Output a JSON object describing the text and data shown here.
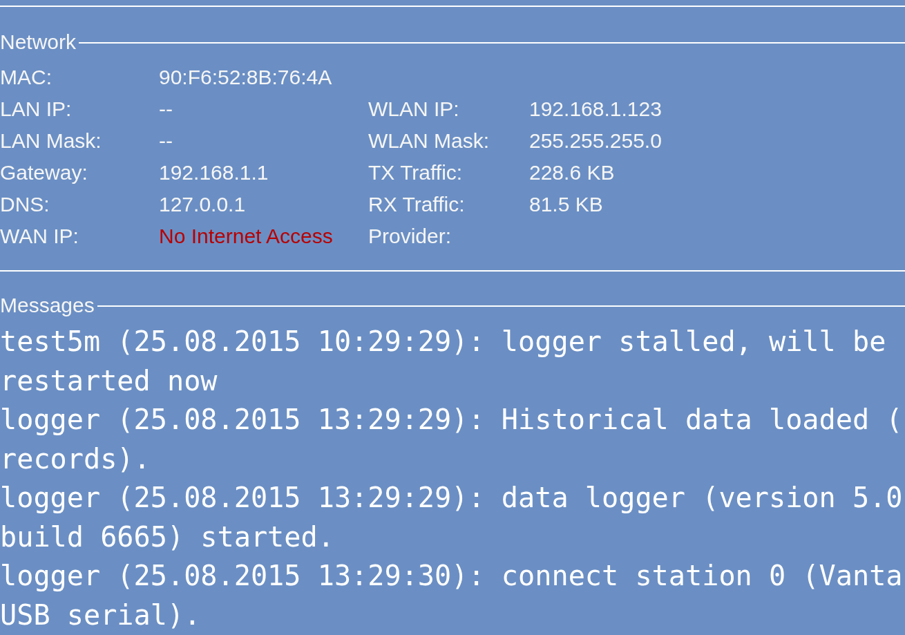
{
  "network": {
    "title": "Network",
    "rows": [
      {
        "pairs": [
          {
            "label": "MAC:",
            "value": "90:F6:52:8B:76:4A",
            "alert": false
          }
        ]
      },
      {
        "pairs": [
          {
            "label": "LAN IP:",
            "value": "--",
            "alert": false
          },
          {
            "label": "WLAN IP:",
            "value": "192.168.1.123",
            "alert": false
          }
        ]
      },
      {
        "pairs": [
          {
            "label": "LAN Mask:",
            "value": "--",
            "alert": false
          },
          {
            "label": "WLAN Mask:",
            "value": "255.255.255.0",
            "alert": false
          }
        ]
      },
      {
        "pairs": [
          {
            "label": "Gateway:",
            "value": "192.168.1.1",
            "alert": false
          },
          {
            "label": "TX Traffic:",
            "value": "228.6 KB",
            "alert": false
          }
        ]
      },
      {
        "pairs": [
          {
            "label": "DNS:",
            "value": "127.0.0.1",
            "alert": false
          },
          {
            "label": "RX Traffic:",
            "value": "81.5 KB",
            "alert": false
          }
        ]
      },
      {
        "pairs": [
          {
            "label": "WAN IP:",
            "value": "No Internet Access",
            "alert": true
          },
          {
            "label": "Provider:"
          }
        ]
      }
    ]
  },
  "messages": {
    "title": "Messages",
    "entries": [
      {
        "lines": [
          "test5m (25.08.2015 10:29:29): logger stalled, will be",
          "restarted now"
        ]
      },
      {
        "lines": [
          "logger (25.08.2015 13:29:29): Historical data loaded (",
          "records)."
        ]
      },
      {
        "lines": [
          "logger (25.08.2015 13:29:29): data logger (version 5.0",
          "build 6665) started."
        ]
      },
      {
        "lines": [
          "logger (25.08.2015 13:29:30): connect station 0 (Vanta",
          "USB serial)."
        ]
      }
    ]
  }
}
